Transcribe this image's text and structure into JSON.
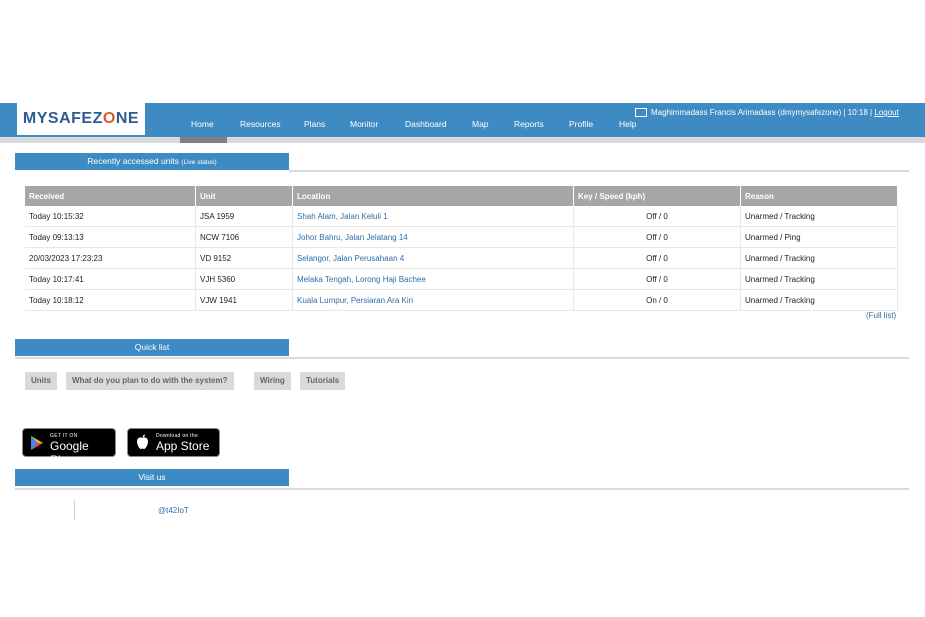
{
  "header": {
    "logo_prefix": "MYSAFEZ",
    "logo_o": "O",
    "logo_suffix": "NE",
    "nav": [
      "Home",
      "Resources",
      "Plans",
      "Monitor",
      "Dashboard",
      "Map",
      "Reports",
      "Profile",
      "Help"
    ],
    "active_nav": "Home",
    "user_text": "Maghimmadass Francis Arimadass (dmymysafezone) | 10:18 |",
    "logout_label": "Logout"
  },
  "recent": {
    "title": "Recently accessed units",
    "title_note": "(Live status)",
    "columns": [
      "Received",
      "Unit",
      "Location",
      "Key / Speed (kph)",
      "Reason"
    ],
    "rows": [
      {
        "received": "Today 10:15:32",
        "unit": "JSA 1959",
        "location": "Shah Alam, Jalan Keluli 1",
        "key_speed": "Off / 0",
        "reason": "Unarmed / Tracking"
      },
      {
        "received": "Today 09:13:13",
        "unit": "NCW 7106",
        "location": "Johor Bahru, Jalan Jelatang 14",
        "key_speed": "Off / 0",
        "reason": "Unarmed / Ping"
      },
      {
        "received": "20/03/2023 17:23:23",
        "unit": "VD 9152",
        "location": "Selangor, Jalan Perusahaan 4",
        "key_speed": "Off / 0",
        "reason": "Unarmed / Tracking"
      },
      {
        "received": "Today 10:17:41",
        "unit": "VJH 5360",
        "location": "Melaka Tengah, Lorong Haji Bachee",
        "key_speed": "Off / 0",
        "reason": "Unarmed / Tracking"
      },
      {
        "received": "Today 10:18:12",
        "unit": "VJW 1941",
        "location": "Kuala Lumpur, Persiaran Ara Kiri",
        "key_speed": "On / 0",
        "reason": "Unarmed / Tracking"
      }
    ],
    "full_list_label": "(Full list)"
  },
  "quick": {
    "title": "Quick list",
    "buttons": [
      "Units",
      "What do you plan to do with the system?",
      "Wiring",
      "Tutorials"
    ]
  },
  "stores": {
    "google_small": "GET IT ON",
    "google_big": "Google Play",
    "apple_small": "Download on the",
    "apple_big": "App Store"
  },
  "visit": {
    "title": "Visit us",
    "handle": "@t42IoT"
  },
  "colors": {
    "header_blue": "#3d8bc2",
    "link_blue": "#2e6ea6",
    "table_header_gray": "#a6a6a6"
  }
}
